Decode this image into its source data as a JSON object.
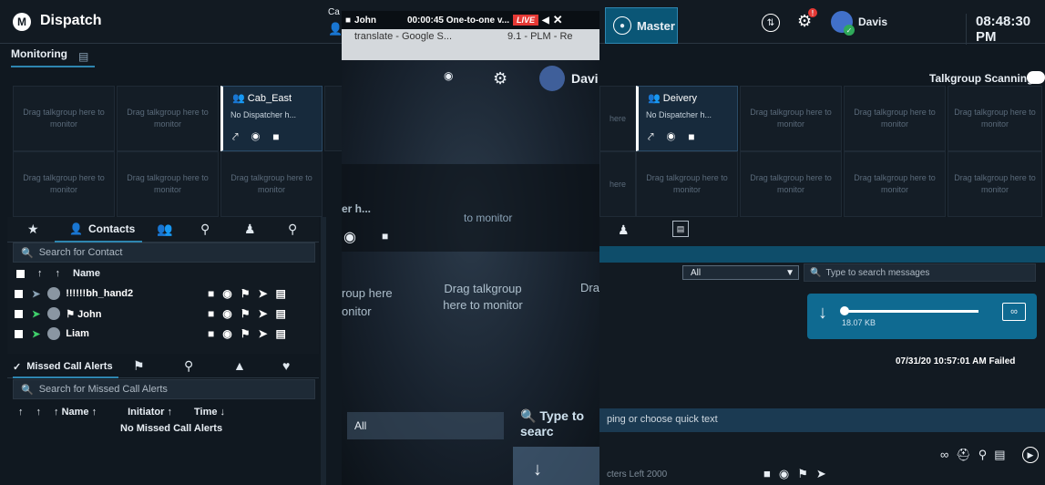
{
  "header": {
    "brand": "Dispatch",
    "master": "Master",
    "user": "Davis",
    "clock": "08:48:30 PM",
    "call_label": "Ca"
  },
  "monitoring": {
    "tab": "Monitoring",
    "talkgroup_scanning": "Talkgroup Scanning",
    "placeholder": "Drag talkgroup here to monitor",
    "active_cells": [
      {
        "name": "Cab_East",
        "status": "No Dispatcher h..."
      },
      {
        "name": "Deivery",
        "status": "No Dispatcher h..."
      }
    ]
  },
  "contacts": {
    "tab_label": "Contacts",
    "search_placeholder": "Search for Contact",
    "column": "Name",
    "rows": [
      {
        "name": "!!!!!!bh_hand2"
      },
      {
        "name": "John"
      },
      {
        "name": "Liam"
      }
    ]
  },
  "missed": {
    "tab_label": "Missed Call Alerts",
    "search_placeholder": "Search for Missed Call Alerts",
    "col_name": "Name",
    "col_initiator": "Initiator",
    "col_time": "Time",
    "empty": "No Missed Call Alerts"
  },
  "messages": {
    "filter": "All",
    "search_placeholder": "Type to search messages",
    "file_size": "18.07 KB",
    "meta": "07/31/20 10:57:01 AM Failed",
    "compose_placeholder": "ping or choose quick text",
    "chars_left": "cters Left 2000"
  },
  "overlay": {
    "caller": "John",
    "call_info": "00:00:45 One-to-one v...",
    "live": "LIVE",
    "tab1": "translate - Google S...",
    "tab2": "9.1 - PLM - Re",
    "user": "Davi",
    "drag_text": "Drag talkgroup here to monitor",
    "roup_text": "roup here",
    "onitor_text": "onitor",
    "dr_text": "Dra",
    "er_text": "er h...",
    "to_monitor": "to monitor",
    "all_text": "All",
    "type_to_search": "Type to searc",
    "partial_here": "here"
  }
}
